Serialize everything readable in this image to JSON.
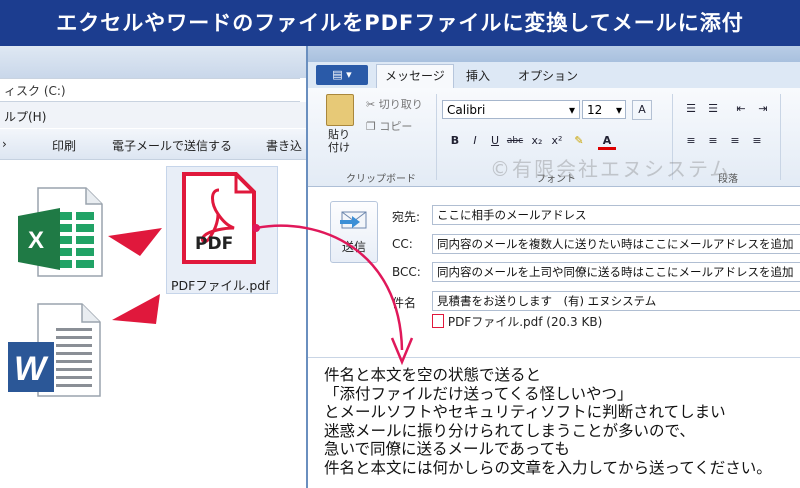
{
  "banner": {
    "title": "エクセルやワードのファイルをPDFファイルに変換してメールに添付"
  },
  "explorer": {
    "address": "ィスク (C:)",
    "menu_help": "ルプ(H)",
    "toolbar": [
      "印刷",
      "電子メールで送信する",
      "書き込"
    ],
    "pdf_file_label": "PDFファイル.pdf",
    "pdf_icon_text": "PDF"
  },
  "outlook": {
    "tabs": [
      "メッセージ",
      "挿入",
      "オプション"
    ],
    "ribbon": {
      "paste": "貼り付け",
      "cut": "切り取り",
      "copy": "コピー",
      "clipboard_group": "クリップボード",
      "font_name": "Calibri",
      "font_size": "12",
      "font_group": "フォント",
      "paragraph_group": "段落"
    },
    "send_label": "送信",
    "fields": {
      "to_label": "宛先:",
      "to_value": "ここに相手のメールアドレス",
      "cc_label": "CC:",
      "cc_value": "同内容のメールを複数人に送りたい時はここにメールアドレスを追加",
      "bcc_label": "BCC:",
      "bcc_value": "同内容のメールを上司や同僚に送る時はここにメールアドレスを追加",
      "subject_label": "件名",
      "subject_value": "見積書をお送りします　(有) エヌシステム",
      "attachment": "PDFファイル.pdf (20.3 KB)"
    },
    "watermark": "©有限会社エヌシステム",
    "body_lines": [
      "件名と本文を空の状態で送ると",
      "「添付ファイルだけ送ってくる怪しいやつ」",
      "とメールソフトやセキュリティソフトに判断されてしまい",
      "迷惑メールに振り分けられてしまうことが多いので、",
      "急いで同僚に送るメールであっても",
      "件名と本文には何かしらの文章を入力してから送ってください。"
    ]
  },
  "colors": {
    "banner": "#1c3d8f",
    "accent_red": "#e0183c",
    "excel_green": "#1f7a45",
    "word_blue": "#2b5797"
  }
}
